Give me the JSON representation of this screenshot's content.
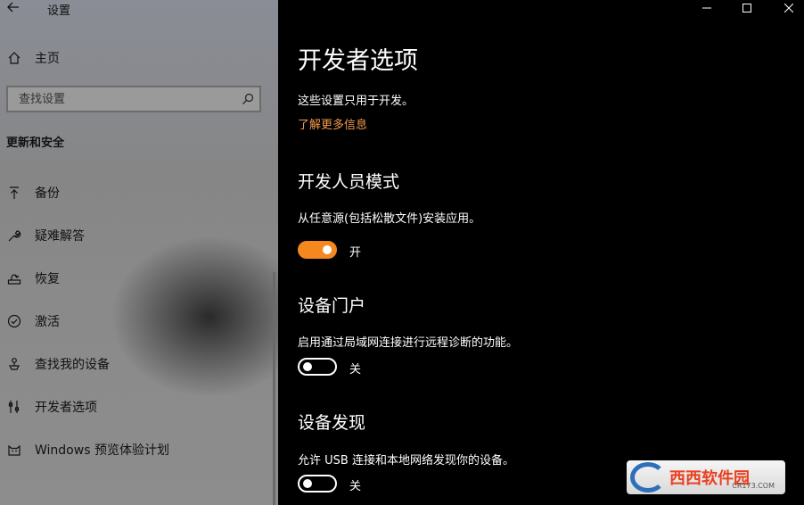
{
  "window": {
    "title": "设置",
    "controls": [
      "minimize-icon",
      "maximize-icon",
      "close-icon"
    ]
  },
  "sidebar": {
    "home_label": "主页",
    "search_placeholder": "查找设置",
    "section_title": "更新和安全",
    "items": [
      {
        "label": "备份",
        "icon": "backup-icon"
      },
      {
        "label": "疑难解答",
        "icon": "wrench-icon"
      },
      {
        "label": "恢复",
        "icon": "recovery-icon"
      },
      {
        "label": "激活",
        "icon": "check-circle-icon"
      },
      {
        "label": "查找我的设备",
        "icon": "find-device-icon"
      },
      {
        "label": "开发者选项",
        "icon": "developer-tools-icon"
      },
      {
        "label": "Windows 预览体验计划",
        "icon": "insider-cat-icon"
      }
    ]
  },
  "main": {
    "title": "开发者选项",
    "intro": "这些设置只用于开发。",
    "learn_more": "了解更多信息",
    "sections": [
      {
        "heading": "开发人员模式",
        "description": "从任意源(包括松散文件)安装应用。",
        "toggle_on": true,
        "state_label": "开"
      },
      {
        "heading": "设备门户",
        "description": "启用通过局域网连接进行远程诊断的功能。",
        "toggle_on": false,
        "state_label": "关"
      },
      {
        "heading": "设备发现",
        "description": "允许 USB 连接和本地网络发现你的设备。",
        "toggle_on": false,
        "state_label": "关"
      }
    ]
  },
  "watermark": {
    "text": "西西软件园",
    "sub": "CR173.COM"
  },
  "colors": {
    "accent": "#f5871f",
    "link": "#f39a4b",
    "background": "#000000"
  }
}
